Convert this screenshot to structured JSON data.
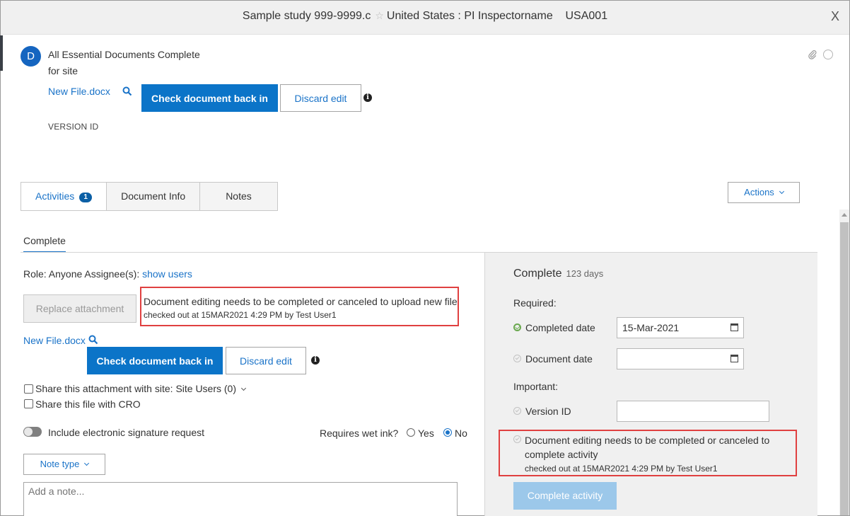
{
  "window": {
    "title_part1": "Sample study 999-9999.c",
    "title_part2": "United States : PI Inspectorname    USA001",
    "close_label": "X"
  },
  "document": {
    "avatar_letter": "D",
    "title": "All Essential Documents Complete",
    "subtitle": "for site",
    "file_name": "New File.docx",
    "check_in_label": "Check document back in",
    "discard_label": "Discard edit",
    "info_glyph": "i",
    "version_label": "VERSION ID"
  },
  "tabs": [
    {
      "label": "Activities",
      "badge": "1"
    },
    {
      "label": "Document Info"
    },
    {
      "label": "Notes"
    }
  ],
  "actions_label": "Actions",
  "activity": {
    "tab_label": "Complete",
    "role_text": "Role: Anyone Assignee(s): ",
    "show_users": "show users",
    "replace_label": "Replace attachment",
    "warning_upload": "Document editing needs to be completed or canceled to upload new file",
    "checked_out": "checked out at 15MAR2021 4:29 PM by Test User1",
    "file_name": "New File.docx",
    "check_in_label": "Check document back in",
    "discard_label": "Discard edit",
    "share_site_label": "Share this attachment with site:",
    "share_site_value": "Site Users (0)",
    "share_cro_label": "Share this file with CRO",
    "esig_label": "Include electronic signature request",
    "wet_ink_label": "Requires wet ink?",
    "wet_ink_yes": "Yes",
    "wet_ink_no": "No",
    "wet_ink_selected": "No",
    "note_type_label": "Note type",
    "note_placeholder": "Add a note..."
  },
  "complete_panel": {
    "title": "Complete",
    "days": "123 days",
    "required_label": "Required:",
    "completed_date_label": "Completed date",
    "completed_date_value": "15-Mar-2021",
    "document_date_label": "Document date",
    "document_date_value": "",
    "important_label": "Important:",
    "version_id_label": "Version ID",
    "warning_line1": "Document editing needs to be completed or canceled to",
    "warning_line2": "complete activity",
    "checked_out": "checked out at 15MAR2021 4:29 PM by Test User1",
    "complete_button": "Complete activity"
  },
  "colors": {
    "primary": "#0b74c8",
    "link": "#1a73c8",
    "warning_border": "#e04040",
    "disabled_button": "#9cc8ea",
    "success": "#6aa84f"
  }
}
